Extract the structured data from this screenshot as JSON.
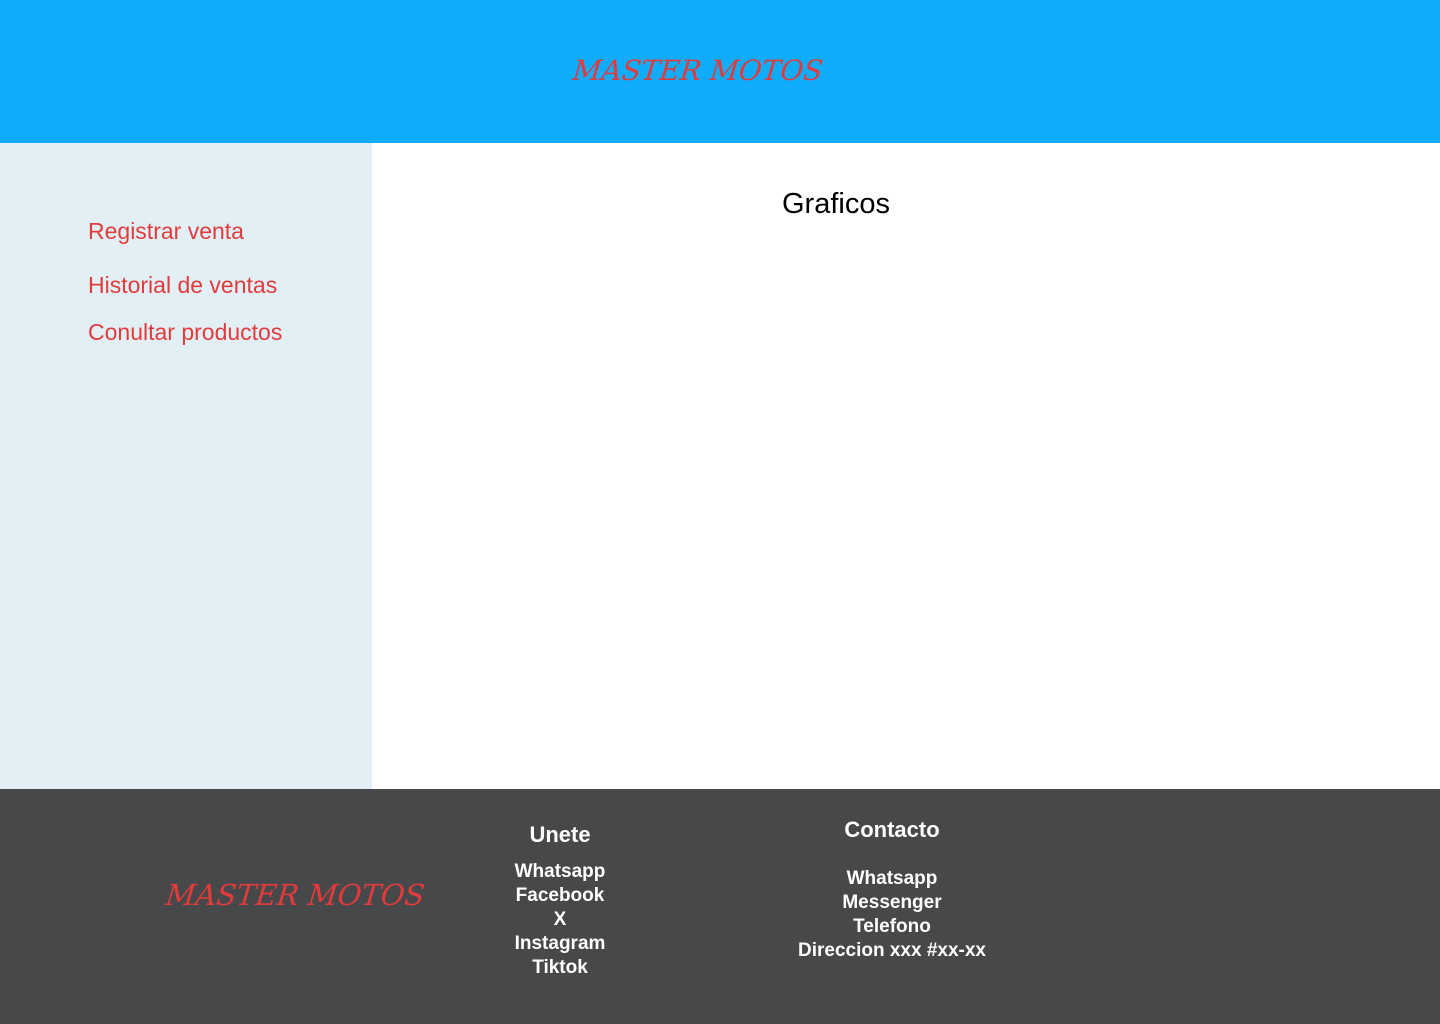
{
  "header": {
    "brand": "MASTER MOTOS"
  },
  "sidebar": {
    "items": [
      {
        "label": "Registrar venta"
      },
      {
        "label": "Historial de ventas"
      },
      {
        "label": "Conultar productos"
      }
    ]
  },
  "main": {
    "title": "Graficos"
  },
  "footer": {
    "brand": "MASTER MOTOS",
    "unete": {
      "heading": "Unete",
      "links": [
        "Whatsapp",
        "Facebook",
        "X",
        "Instagram",
        "Tiktok"
      ]
    },
    "contacto": {
      "heading": "Contacto",
      "links": [
        "Whatsapp",
        "Messenger",
        "Telefono",
        "Direccion xxx #xx-xx"
      ]
    }
  },
  "colors": {
    "header_bg": "#10acfc",
    "sidebar_bg": "#e2f0f6",
    "footer_bg": "#47484a",
    "accent": "#e23b3b"
  }
}
